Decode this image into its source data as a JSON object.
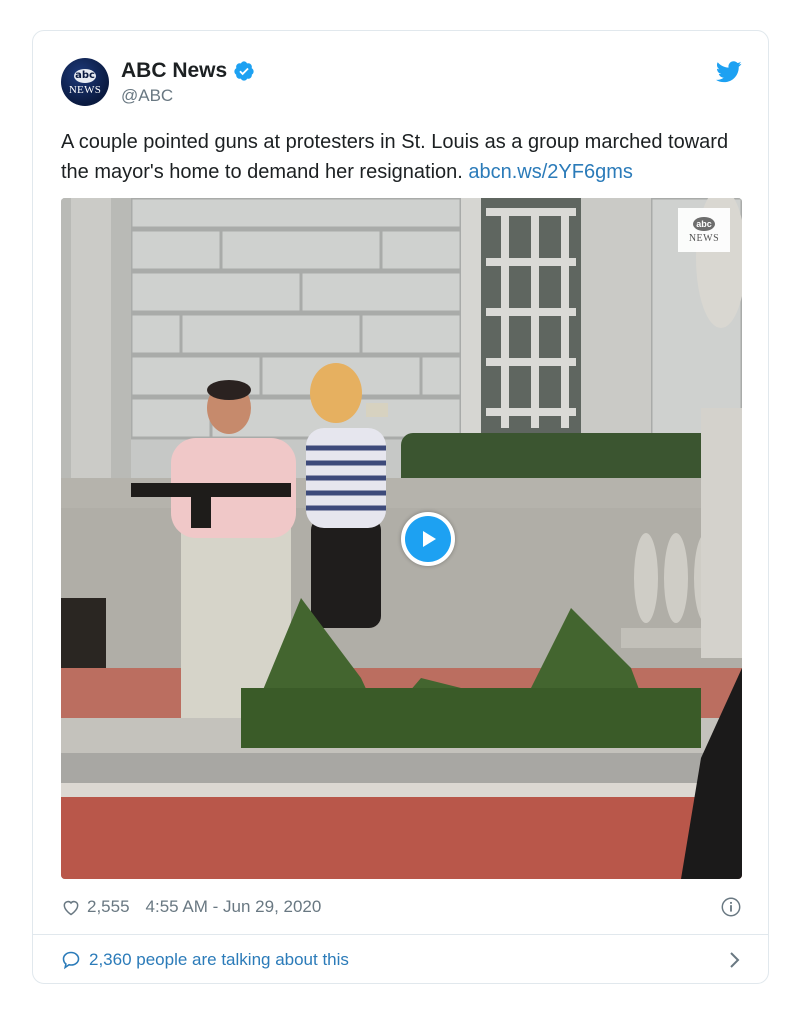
{
  "author": {
    "display_name": "ABC News",
    "handle": "@ABC",
    "avatar_text_top": "abc",
    "avatar_text_bottom": "NEWS"
  },
  "tweet": {
    "text": "A couple pointed guns at protesters in St. Louis as a group marched toward the mayor's home to demand her resignation. ",
    "link": "abcn.ws/2YF6gms"
  },
  "media": {
    "watermark_top": "abc",
    "watermark_bottom": "NEWS",
    "play_icon": "play-icon"
  },
  "meta": {
    "likes": "2,555",
    "timestamp": "4:55 AM - Jun 29, 2020"
  },
  "conversation": {
    "label": "2,360 people are talking about this"
  },
  "colors": {
    "twitter_blue": "#1da1f2",
    "link_blue": "#2b7bb9",
    "muted_gray": "#697882",
    "border": "#e1e8ed"
  }
}
